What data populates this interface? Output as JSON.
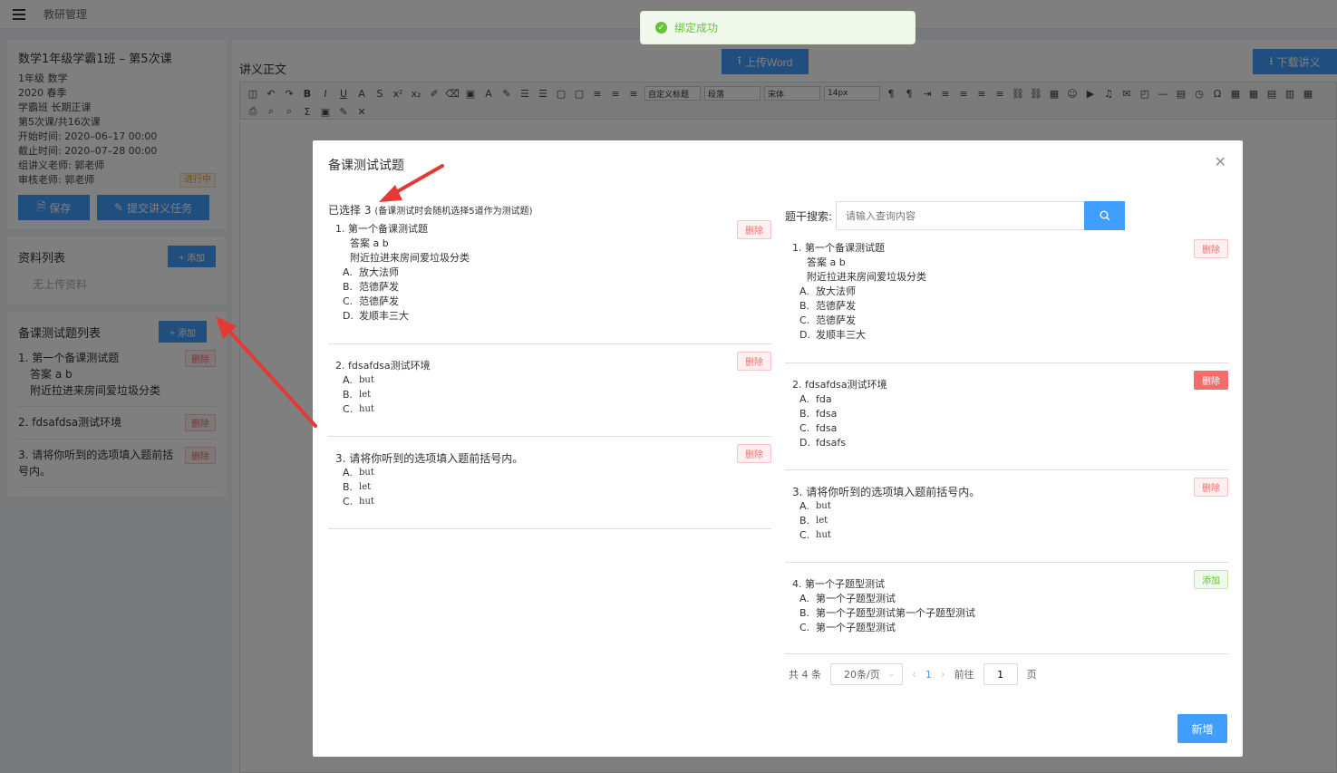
{
  "topbar": {
    "breadcrumb": "教研管理"
  },
  "course": {
    "title": "数学1年级学霸1班 – 第5次课",
    "lines": [
      "1年级  数学",
      "2020  春季",
      "学霸班  长期正课",
      "第5次课/共16次课",
      "开始时间: 2020–06–17 00:00",
      "截止时间: 2020–07–28 00:00",
      "组讲义老师: 郭老师"
    ],
    "reviewer": "审核老师: 郭老师",
    "status": "进行中",
    "save_label": "保存",
    "submit_label": "提交讲义任务"
  },
  "materials": {
    "title": "资料列表",
    "add_label": "+ 添加",
    "empty": "无上传资料"
  },
  "prep_list": {
    "title": "备课测试题列表",
    "add_label": "+ 添加",
    "delete_label": "删除",
    "items": [
      {
        "text": "1. 第一个备课测试题",
        "sub1": "答案 a b",
        "sub2": "附近拉进来房间爱垃圾分类"
      },
      {
        "text": "2. fdsafdsa测试环境"
      },
      {
        "text": "3. 请将你听到的选项填入题前括号内。"
      }
    ]
  },
  "editor": {
    "label": "讲义正文",
    "upload_label": "上传Word",
    "download_label": "下载讲义",
    "selects": [
      "自定义标题",
      "段落",
      "宋体",
      "14px"
    ]
  },
  "toast": {
    "text": "绑定成功"
  },
  "dialog": {
    "title": "备课测试试题",
    "selected_prefix": "已选择",
    "selected_count": "3",
    "selected_note": "(备课测试时会随机选择5道作为测试题)",
    "search_label": "题干搜索:",
    "search_placeholder": "请输入查询内容",
    "selected": [
      {
        "stem": "1.  第一个备课测试题",
        "subs": [
          "答案 a b",
          "附近拉进来房间爱垃圾分类"
        ],
        "options": [
          [
            "A.",
            "放大法师"
          ],
          [
            "B.",
            "范德萨发"
          ],
          [
            "C.",
            "范德萨发"
          ],
          [
            "D.",
            "发顺丰三大"
          ]
        ],
        "action": "删除"
      },
      {
        "stem": "2.  fdsafdsa测试环境",
        "subs": [],
        "options": [
          [
            "A.",
            "but"
          ],
          [
            "B.",
            "let"
          ],
          [
            "C.",
            "hut"
          ]
        ],
        "action": "删除"
      },
      {
        "stem": "3.  请将你听到的选项填入题前括号内。",
        "subs": [],
        "options": [
          [
            "A.",
            "but"
          ],
          [
            "B.",
            "let"
          ],
          [
            "C.",
            "hut"
          ]
        ],
        "action": "删除"
      }
    ],
    "results": [
      {
        "stem": "1.  第一个备课测试题",
        "subs": [
          "答案 a b",
          "附近拉进来房间爱垃圾分类"
        ],
        "options": [
          [
            "A.",
            "放大法师"
          ],
          [
            "B.",
            "范德萨发"
          ],
          [
            "C.",
            "范德萨发"
          ],
          [
            "D.",
            "发顺丰三大"
          ]
        ],
        "action": "删除"
      },
      {
        "stem": "2.  fdsafdsa测试环境",
        "subs": [],
        "options": [
          [
            "A.",
            "fda"
          ],
          [
            "B.",
            "fdsa"
          ],
          [
            "C.",
            "fdsa"
          ],
          [
            "D.",
            "fdsafs"
          ]
        ],
        "action": "删除"
      },
      {
        "stem": "3.  请将你听到的选项填入题前括号内。",
        "subs": [],
        "options": [
          [
            "A.",
            "but"
          ],
          [
            "B.",
            "let"
          ],
          [
            "C.",
            "hut"
          ]
        ],
        "action": "删除"
      },
      {
        "stem": "4.  第一个子题型测试",
        "subs": [],
        "options": [
          [
            "A.",
            "第一个子题型测试"
          ],
          [
            "B.",
            "第一个子题型测试第一个子题型测试"
          ],
          [
            "C.",
            "第一个子题型测试"
          ]
        ],
        "action": "添加"
      }
    ],
    "pager": {
      "total": "共 4 条",
      "page_size": "20条/页",
      "current": "1",
      "goto_label": "前往",
      "goto_value": "1",
      "page_suffix": "页"
    },
    "new_label": "新增"
  },
  "colors": {
    "primary": "#409eff",
    "danger": "#f56c6c",
    "success": "#67c23a",
    "annotation": "#e53935"
  }
}
